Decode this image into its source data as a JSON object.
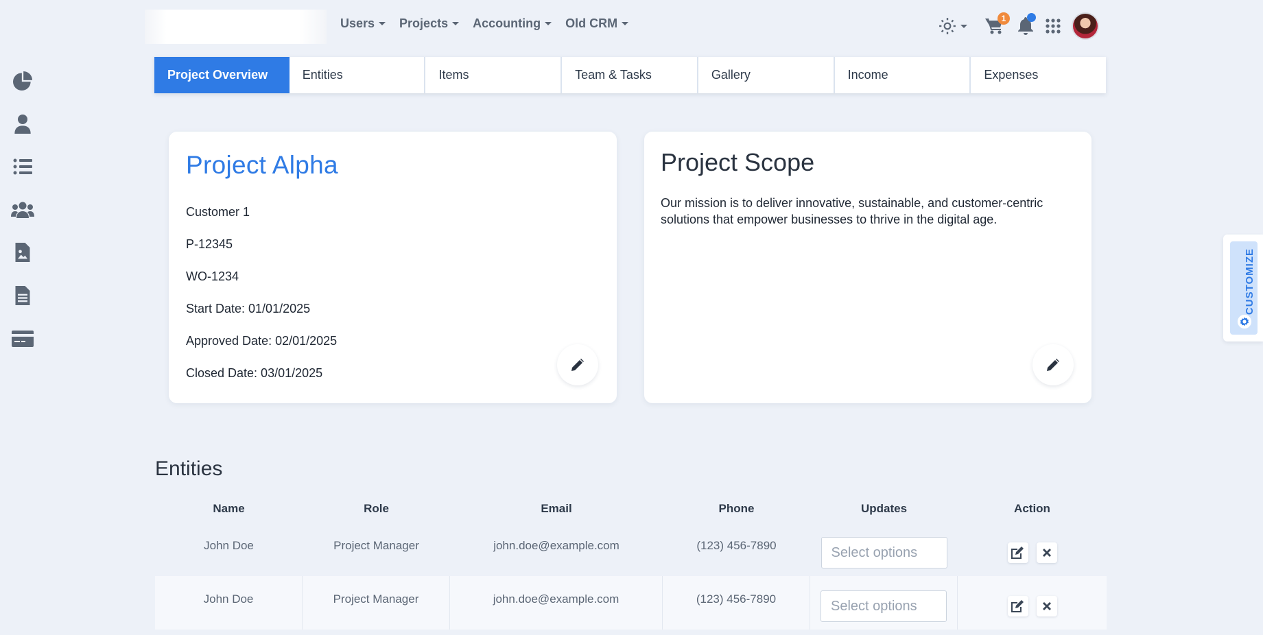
{
  "nav": {
    "menus": [
      "Users",
      "Projects",
      "Accounting",
      "Old CRM"
    ],
    "cart_count": "1"
  },
  "sidebar": {
    "icons": [
      "pie-chart-icon",
      "user-icon",
      "list-icon",
      "users-icon",
      "image-file-icon",
      "document-icon",
      "credit-card-icon"
    ]
  },
  "tabs": [
    "Project Overview",
    "Entities",
    "Items",
    "Team & Tasks",
    "Gallery",
    "Income",
    "Expenses"
  ],
  "project": {
    "name": "Project Alpha",
    "customer": "Customer 1",
    "project_number": "P-12345",
    "work_order": "WO-1234",
    "start_date": "Start Date: 01/01/2025",
    "approved_date": "Approved Date: 02/01/2025",
    "closed_date": "Closed Date: 03/01/2025"
  },
  "scope": {
    "title": "Project Scope",
    "text": "Our mission is to deliver innovative, sustainable, and customer-centric solutions that empower businesses to thrive in the digital age."
  },
  "customize": {
    "label": "CUSTOMIZE"
  },
  "entities": {
    "title": "Entities",
    "columns": [
      "Name",
      "Role",
      "Email",
      "Phone",
      "Updates",
      "Action"
    ],
    "select_placeholder": "Select options",
    "rows": [
      {
        "name": "John Doe",
        "role": "Project Manager",
        "email": "john.doe@example.com",
        "phone": "(123) 456-7890"
      },
      {
        "name": "John Doe",
        "role": "Project Manager",
        "email": "john.doe@example.com",
        "phone": "(123) 456-7890"
      }
    ]
  },
  "colors": {
    "accent": "#2f7be5",
    "background": "#edf1f8",
    "badge": "#f08a3c"
  }
}
